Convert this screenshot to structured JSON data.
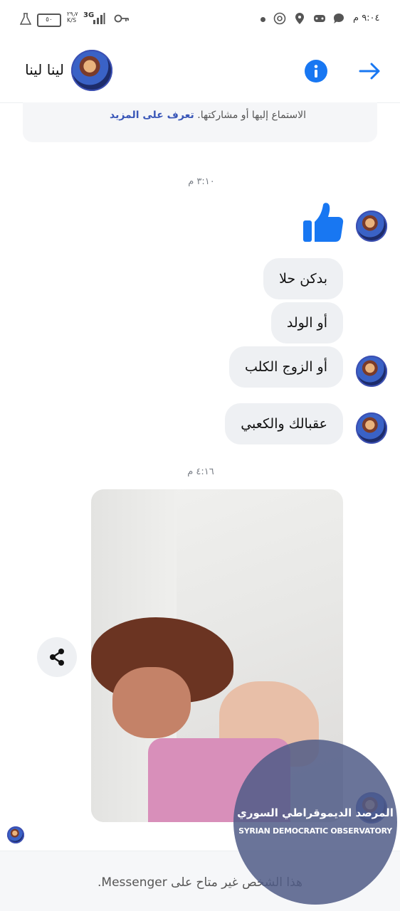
{
  "status_bar": {
    "time": "٩:٠٤ م",
    "network": "3G",
    "speed": "٢٩٫٧\nK/S",
    "battery": "٥٠"
  },
  "header": {
    "contact_name": "لينا لينا",
    "info_icon": "info-icon",
    "back_icon": "arrow-right-icon",
    "accent_color": "#1877f2"
  },
  "notice": {
    "text": "الاستماع إليها أو مشاركتها.",
    "link": "تعرف على المزيد"
  },
  "messages": {
    "time_1": "٣:١٠ م",
    "like_icon": "thumbs-up-icon",
    "bubble_1": "بدكن حلا",
    "bubble_2": "أو الولد",
    "bubble_3": "أو الزوج الكلب",
    "bubble_4": "عقبالك والكعبي",
    "time_2": "٤:١٦ م",
    "share_icon": "share-icon"
  },
  "watermark": {
    "arabic": "المرصد الديموقراطي السوري",
    "english": "SYRIAN DEMOCRATIC OBSERVATORY"
  },
  "footer": {
    "text": "هذا الشخص غير متاح على Messenger."
  }
}
